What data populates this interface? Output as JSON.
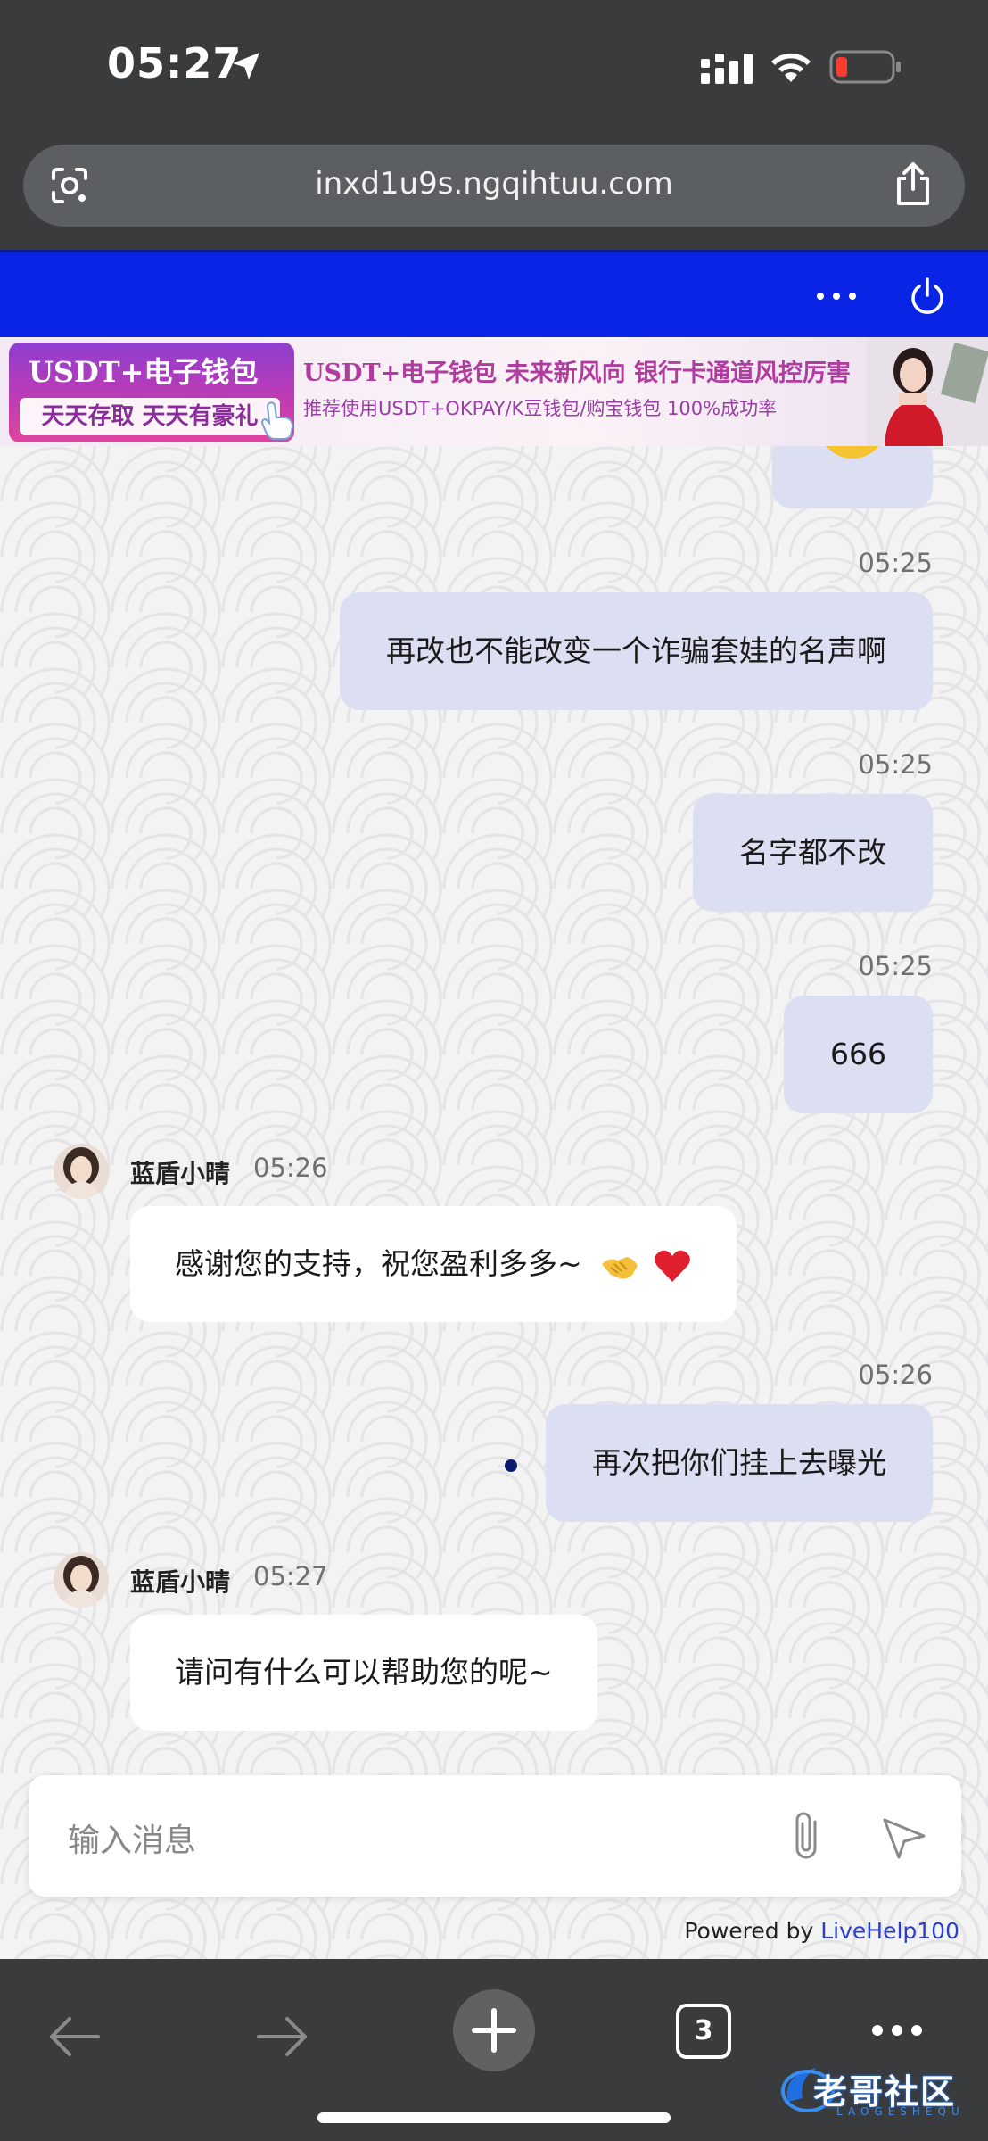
{
  "status_bar": {
    "time": "05:27"
  },
  "browser": {
    "url": "inxd1u9s.ngqihtuu.com"
  },
  "banner": {
    "left_top": "USDT+电子钱包",
    "left_bottom": "天天存取 天天有豪礼",
    "line1": "USDT+电子钱包  未来新风向  银行卡通道风控厉害",
    "line2": "推荐使用USDT+OKPAY/K豆钱包/购宝钱包  100%成功率"
  },
  "messages": [
    {
      "type": "out",
      "time": "05:25",
      "text": "再改也不能改变一个诈骗套娃的名声啊"
    },
    {
      "type": "out",
      "time": "05:25",
      "text": "名字都不改"
    },
    {
      "type": "out",
      "time": "05:25",
      "text": "666"
    },
    {
      "type": "in",
      "name": "蓝盾小晴",
      "time": "05:26",
      "text": "感谢您的支持，祝您盈利多多~"
    },
    {
      "type": "out",
      "time": "05:26",
      "text": "再次把你们挂上去曝光"
    },
    {
      "type": "in",
      "name": "蓝盾小晴",
      "time": "05:27",
      "text": "请问有什么可以帮助您的呢~"
    }
  ],
  "composer": {
    "placeholder": "输入消息"
  },
  "footer": {
    "powered_by": "Powered by ",
    "powered_link": "LiveHelp100"
  },
  "toolbar": {
    "tab_count": "3"
  },
  "watermark": {
    "text": "老哥社区",
    "sub": "LAOGESHEQU"
  },
  "colors": {
    "header_blue": "#0a24e6",
    "bubble_out": "#dcdff2",
    "bubble_in": "#ffffff",
    "link": "#2a3fcf"
  }
}
